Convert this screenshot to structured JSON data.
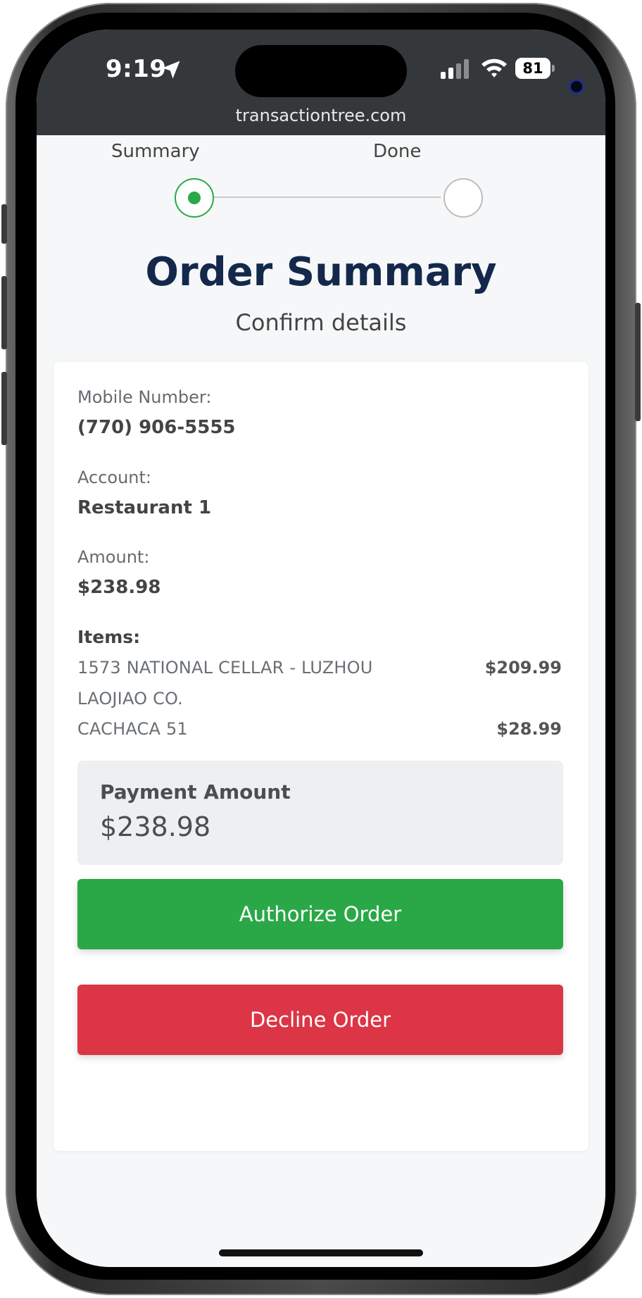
{
  "status_bar": {
    "time": "9:19",
    "battery": "81",
    "url": "transactiontree.com"
  },
  "stepper": {
    "steps": [
      {
        "label": "Summary",
        "state": "active"
      },
      {
        "label": "Done",
        "state": "pending"
      }
    ],
    "active_color": "#2aa847"
  },
  "header": {
    "title": "Order Summary",
    "subtitle": "Confirm details"
  },
  "details": {
    "mobile_label": "Mobile Number:",
    "mobile_value": "(770) 906-5555",
    "account_label": "Account:",
    "account_value": "Restaurant 1",
    "amount_label": "Amount:",
    "amount_value": "$238.98"
  },
  "items": {
    "label": "Items:",
    "list": [
      {
        "name_line1": "1573 NATIONAL CELLAR - LUZHOU",
        "name_line2": "LAOJIAO CO.",
        "price": "$209.99"
      },
      {
        "name_line1": "CACHACA 51",
        "price": "$28.99"
      }
    ]
  },
  "payment": {
    "label": "Payment Amount",
    "value": "$238.98"
  },
  "actions": {
    "authorize_label": "Authorize Order",
    "decline_label": "Decline Order",
    "authorize_color": "#2aa847",
    "decline_color": "#dc3545"
  },
  "colors": {
    "title": "#14284b",
    "status_bar_bg": "#34383b"
  }
}
